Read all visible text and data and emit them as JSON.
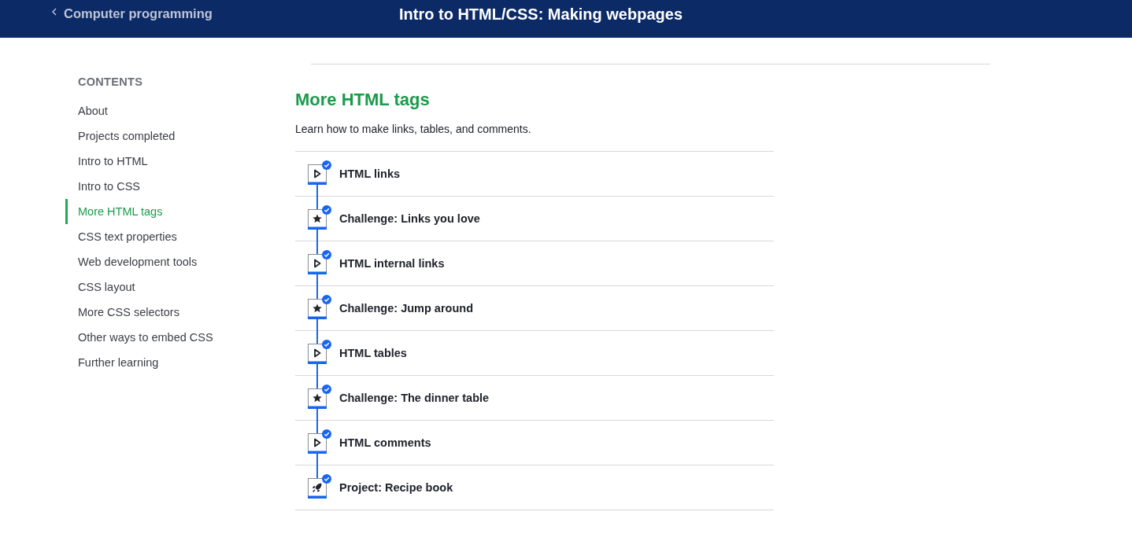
{
  "header": {
    "back_link": "Computer programming",
    "title": "Intro to HTML/CSS: Making webpages"
  },
  "sidebar": {
    "heading": "CONTENTS",
    "items": [
      {
        "label": "About",
        "selected": false
      },
      {
        "label": "Projects completed",
        "selected": false
      },
      {
        "label": "Intro to HTML",
        "selected": false
      },
      {
        "label": "Intro to CSS",
        "selected": false
      },
      {
        "label": "More HTML tags",
        "selected": true
      },
      {
        "label": "CSS text properties",
        "selected": false
      },
      {
        "label": "Web development tools",
        "selected": false
      },
      {
        "label": "CSS layout",
        "selected": false
      },
      {
        "label": "More CSS selectors",
        "selected": false
      },
      {
        "label": "Other ways to embed CSS",
        "selected": false
      },
      {
        "label": "Further learning",
        "selected": false
      }
    ]
  },
  "unit": {
    "title": "More HTML tags",
    "description": "Learn how to make links, tables, and comments.",
    "lessons": [
      {
        "kind": "video",
        "title": "HTML links",
        "completed": true
      },
      {
        "kind": "challenge",
        "title": "Challenge: Links you love",
        "completed": true
      },
      {
        "kind": "video",
        "title": "HTML internal links",
        "completed": true
      },
      {
        "kind": "challenge",
        "title": "Challenge: Jump around",
        "completed": true
      },
      {
        "kind": "video",
        "title": "HTML tables",
        "completed": true
      },
      {
        "kind": "challenge",
        "title": "Challenge: The dinner table",
        "completed": true
      },
      {
        "kind": "video",
        "title": "HTML comments",
        "completed": true
      },
      {
        "kind": "project",
        "title": "Project: Recipe book",
        "completed": true
      }
    ]
  }
}
